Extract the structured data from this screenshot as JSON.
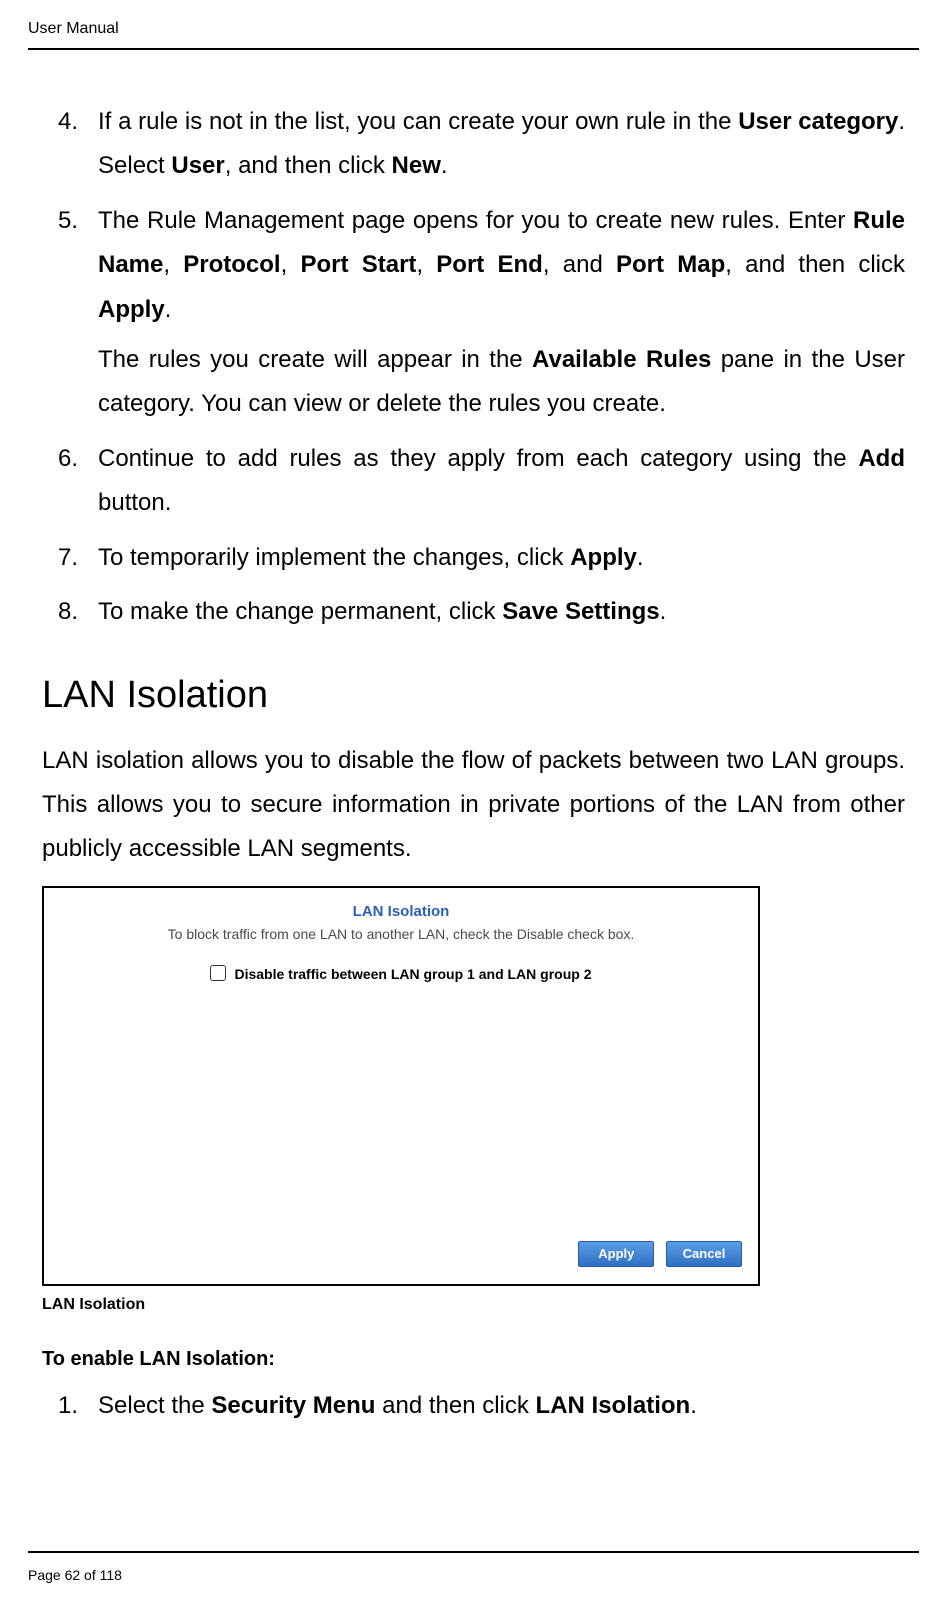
{
  "header": {
    "running": "User Manual"
  },
  "footer": {
    "text": "Page 62 of 118"
  },
  "steps": {
    "s4a": "If a rule is not in the list, you can create your own rule in the ",
    "s4b": "User category",
    "s4c": ". Select ",
    "s4d": "User",
    "s4e": ", and then click ",
    "s4f": "New",
    "s4g": ".",
    "s5a": "The Rule Management page opens for you to create new rules. Enter ",
    "s5b": "Rule Name",
    "s5c": ", ",
    "s5d": "Protocol",
    "s5e": ", ",
    "s5f": "Port Start",
    "s5g": ", ",
    "s5h": "Port End",
    "s5i": ", and ",
    "s5j": "Port Map",
    "s5k": ", and then click ",
    "s5l": "Apply",
    "s5m": ".",
    "s5sub_a": "The rules you create will appear in the ",
    "s5sub_b": "Available Rules",
    "s5sub_c": " pane in the User category. You can view or delete the rules you create.",
    "s6a": "Continue to add rules as they apply from each category using the ",
    "s6b": "Add",
    "s6c": " button.",
    "s7a": "To temporarily implement the changes, click ",
    "s7b": "Apply",
    "s7c": ".",
    "s8a": "To make the change permanent, click ",
    "s8b": "Save Settings",
    "s8c": "."
  },
  "section": {
    "title": "LAN Isolation",
    "body": "LAN isolation allows you to disable the flow of packets between two LAN groups. This allows you to secure information in private portions of the LAN from other publicly accessible LAN segments."
  },
  "figure": {
    "title": "LAN Isolation",
    "subtitle": "To block traffic from one LAN to another LAN, check the Disable check box.",
    "checkbox_label": "Disable traffic between LAN group 1 and LAN group 2",
    "apply": "Apply",
    "cancel": "Cancel",
    "caption": "LAN Isolation"
  },
  "enable": {
    "heading": "To enable LAN Isolation:",
    "step1a": "Select the ",
    "step1b": "Security Menu",
    "step1c": " and then click ",
    "step1d": "LAN Isolation",
    "step1e": "."
  }
}
